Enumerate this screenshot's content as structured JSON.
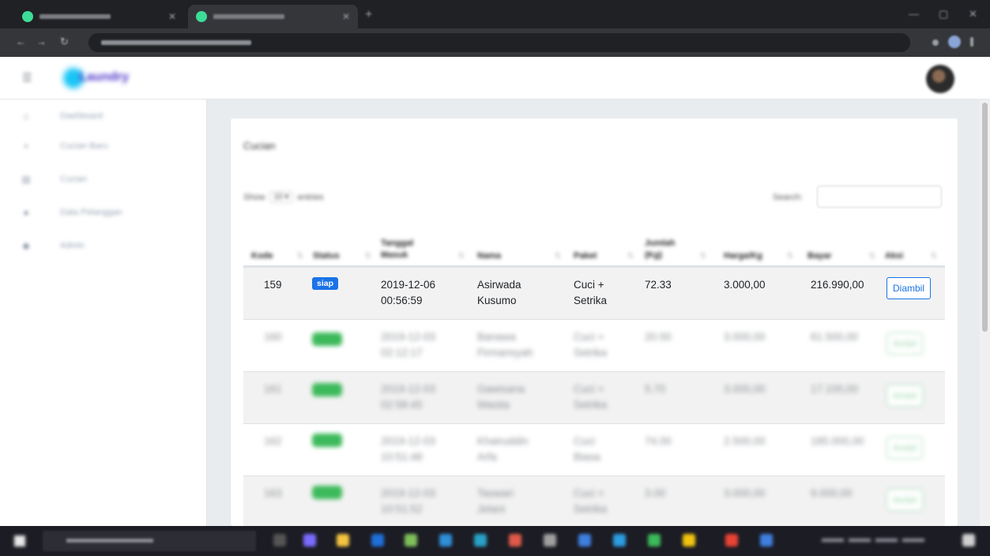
{
  "browser": {
    "tabs": [
      {
        "title": "Laundry",
        "active": false
      },
      {
        "title": "Laundry",
        "active": true
      }
    ],
    "url": "",
    "new_tab_label": "+",
    "window_controls": [
      "—",
      "▢",
      "✕"
    ],
    "nav_buttons": [
      "←",
      "→",
      "↻"
    ]
  },
  "app": {
    "brand": "Laundry",
    "menu_icon": "menu-icon"
  },
  "sidebar": {
    "items": [
      {
        "label": "Dashboard",
        "icon": "home-icon",
        "glyph": "⌂"
      },
      {
        "label": "Cucian Baru",
        "icon": "plus-icon",
        "glyph": "+"
      },
      {
        "label": "Cucian",
        "icon": "basket-icon",
        "glyph": "▤"
      },
      {
        "label": "Data Pelanggan",
        "icon": "users-icon",
        "glyph": "●"
      },
      {
        "label": "Admin",
        "icon": "user-icon",
        "glyph": "◆"
      }
    ]
  },
  "content": {
    "card_title": "Cucian",
    "show_label": "Show",
    "show_value": "10",
    "entries_label": "entries",
    "search_label": "Search:",
    "search_value": ""
  },
  "table": {
    "columns": [
      "Kode",
      "Status",
      "Tanggal Masuk",
      "Nama",
      "Paket",
      "Jumlah (Kg)",
      "Harga/Kg",
      "Bayar",
      "Aksi"
    ],
    "rows": [
      {
        "kode": "159",
        "status": "siap",
        "tanggal": "2019-12-06 00:56:59",
        "nama": "Asirwada Kusumo",
        "paket": "Cuci + Setrika",
        "jumlah": "72.33",
        "harga": "3.000,00",
        "bayar": "216.990,00",
        "aksi": "Diambil",
        "blurred": false
      },
      {
        "kode": "160",
        "status": "",
        "tanggal": "2019-12-03 02:12:17",
        "nama": "Banawa Firmansyah",
        "paket": "Cuci + Setrika",
        "jumlah": "20.50",
        "harga": "3.000,00",
        "bayar": "61.500,00",
        "aksi": "Ambil",
        "blurred": true
      },
      {
        "kode": "161",
        "status": "",
        "tanggal": "2019-12-03 02:58:45",
        "nama": "Gawisana Wasita",
        "paket": "Cuci + Setrika",
        "jumlah": "5.70",
        "harga": "3.000,00",
        "bayar": "17.100,00",
        "aksi": "Ambil",
        "blurred": true
      },
      {
        "kode": "162",
        "status": "",
        "tanggal": "2019-12-03 10:51:48",
        "nama": "Khairuddin Arfa",
        "paket": "Cuci Biasa",
        "jumlah": "74.00",
        "harga": "2.500,00",
        "bayar": "185.000,00",
        "aksi": "Ambil",
        "blurred": true
      },
      {
        "kode": "163",
        "status": "",
        "tanggal": "2019-12-03 10:51:52",
        "nama": "Taswari Jelani",
        "paket": "Cuci + Setrika",
        "jumlah": "3.00",
        "harga": "3.000,00",
        "bayar": "9.000,00",
        "aksi": "Ambil",
        "blurred": true
      }
    ]
  },
  "colors": {
    "badge_siap": "#1a73e8",
    "badge_other": "#3cb95a",
    "button_primary": "#1a73e8",
    "button_other": "#9fd8ae"
  },
  "taskbar": {
    "search_placeholder": "",
    "clock": ""
  }
}
